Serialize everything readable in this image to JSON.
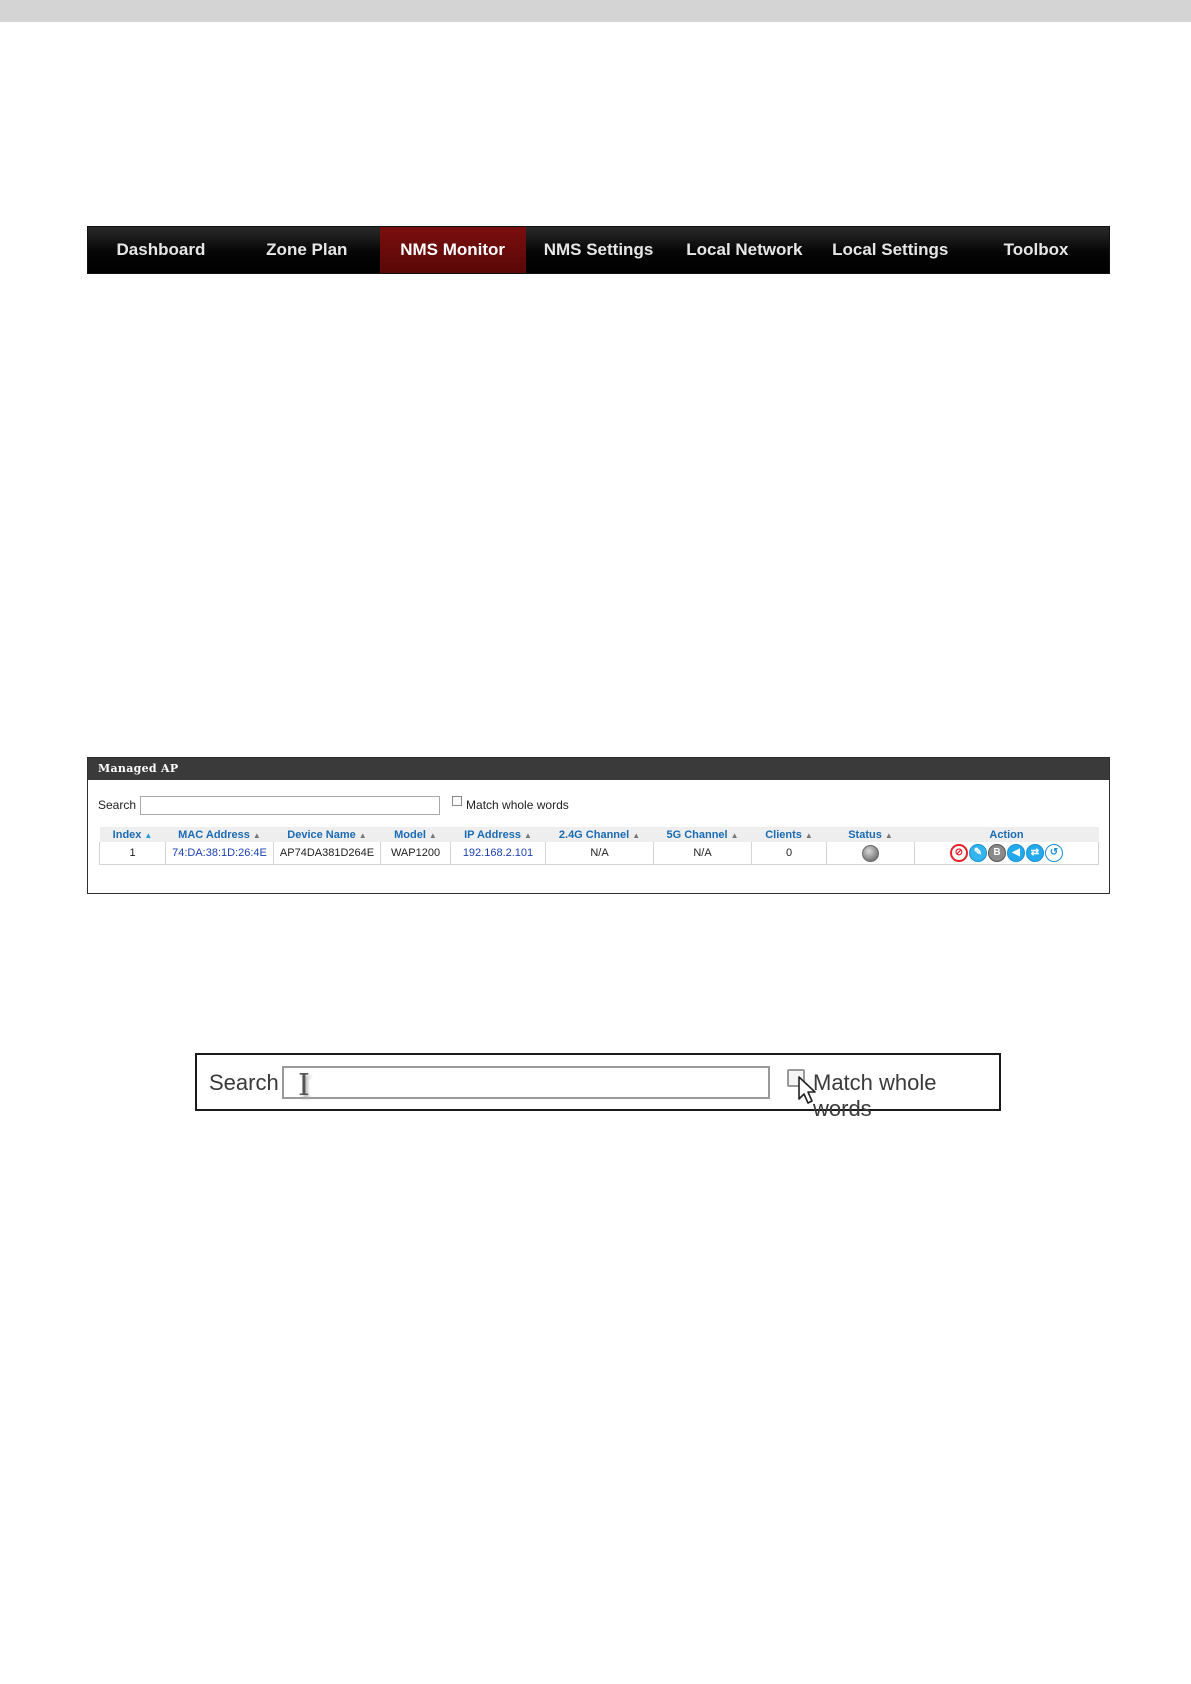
{
  "nav": {
    "items": [
      "Dashboard",
      "Zone Plan",
      "NMS Monitor",
      "NMS Settings",
      "Local Network",
      "Local Settings",
      "Toolbox"
    ],
    "active_index": 2,
    "active_color": "#6b0b0b"
  },
  "managed_ap": {
    "title": "Managed AP",
    "search_label": "Search",
    "search_value": "",
    "match_whole_words_label": "Match whole words",
    "match_whole_words_checked": false,
    "columns": [
      "Index",
      "MAC Address",
      "Device Name",
      "Model",
      "IP Address",
      "2.4G Channel",
      "5G Channel",
      "Clients",
      "Status",
      "Action"
    ],
    "rows": [
      {
        "index": "1",
        "mac": "74:DA:38:1D:26:4E",
        "device_name": "AP74DA381D264E",
        "model": "WAP1200",
        "ip": "192.168.2.101",
        "ch24": "N/A",
        "ch5": "N/A",
        "clients": "0",
        "status": "offline-grey"
      }
    ],
    "action_icons": [
      "block-icon",
      "edit-icon",
      "blink-led-icon",
      "buzzer-icon",
      "network-connectivity-icon",
      "reset-icon"
    ]
  },
  "zoom": {
    "search_label": "Search",
    "match_whole_words_label": "Match whole words"
  }
}
